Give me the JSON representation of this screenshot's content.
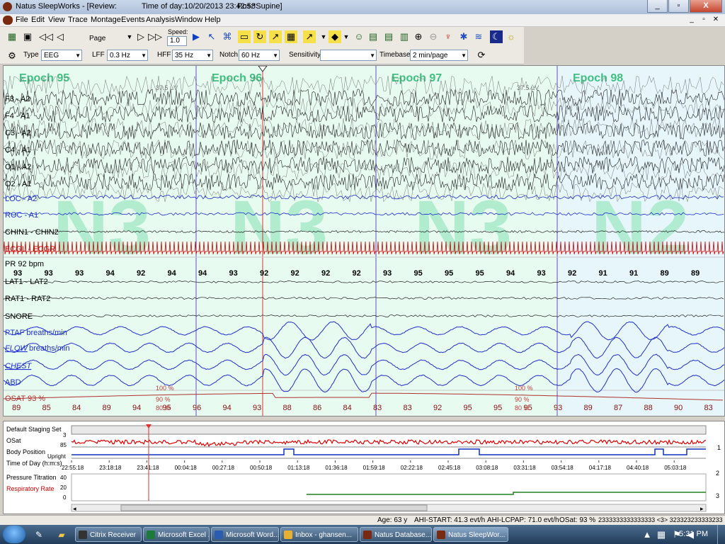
{
  "window": {
    "app_title": "Natus SleepWorks - [Review:",
    "time_of_day": "Time of day:10/20/2013 23:42:58",
    "position": "Pos:*Supine]",
    "controls": [
      "_",
      "▫",
      "X"
    ]
  },
  "menu": [
    "File",
    "Edit",
    "View",
    "Trace",
    "Montage",
    "Events",
    "Analysis",
    "Window",
    "Help"
  ],
  "toolbar": {
    "page_label": "Page",
    "speed_label": "Speed:",
    "speed_value": "1.0"
  },
  "settings": {
    "type_label": "Type",
    "type_value": "EEG",
    "lff_label": "LFF",
    "lff_value": "0.3 Hz",
    "hff_label": "HFF",
    "hff_value": "35 Hz",
    "notch_label": "Notch",
    "notch_value": "60 Hz",
    "sensitivity_label": "Sensitivity",
    "sensitivity_value": "",
    "timebase_label": "Timebase",
    "timebase_value": "2 min/page"
  },
  "epochs": [
    "Epoch 95",
    "Epoch 96",
    "Epoch 97",
    "Epoch 98"
  ],
  "stages": [
    "N3",
    "N3",
    "N3",
    "N2"
  ],
  "scale_labels": [
    "37.5 µV",
    "37.5 µV"
  ],
  "eeg_channels": [
    "F3 - A2",
    "F4 - A1",
    "C3 - A2",
    "C4 - A1",
    "O1 - A2",
    "O2 - A1"
  ],
  "channels": {
    "loc": "LOC - A2",
    "roc": "ROC - A1",
    "chin": "CHIN1 - CHIN2",
    "ecg": "ECGL - ECGR",
    "pr": "PR  92 bpm",
    "lat": "LAT1 - LAT2",
    "rat": "RAT1 - RAT2",
    "snore": "SNORE",
    "ptaf": "PTAF breaths/min",
    "flow": "FLOW",
    "flow_unit": "breaths/min",
    "chest": "CHEST",
    "abd": "ABD",
    "osat": "OSAT 93 %"
  },
  "pr_values": [
    "93",
    "93",
    "93",
    "94",
    "92",
    "94",
    "94",
    "93",
    "92",
    "92",
    "92",
    "92",
    "93",
    "95",
    "95",
    "95",
    "94",
    "93",
    "92",
    "91",
    "91",
    "89",
    "89"
  ],
  "osat_values": [
    "89",
    "85",
    "84",
    "89",
    "94",
    "95",
    "96",
    "94",
    "93",
    "88",
    "86",
    "84",
    "83",
    "83",
    "92",
    "95",
    "95",
    "95",
    "93",
    "89",
    "87",
    "88",
    "90",
    "83"
  ],
  "osat_scale": [
    "100 %",
    "90 %",
    "80 %",
    "100 %",
    "90 %",
    "80 %"
  ],
  "lower_panel": {
    "staging_label": "Default Staging Set",
    "staging_value": "3",
    "osat_label": "OSat",
    "osat_scale": "85",
    "body_label": "Body Position",
    "body_value": "Upright",
    "tod_label": "Time of Day (h:m:s)",
    "times": [
      "22:55:18",
      "23:18:18",
      "23:41:18",
      "00:04:18",
      "00:27:18",
      "00:50:18",
      "01:13:18",
      "01:36:18",
      "01:59:18",
      "02:22:18",
      "02:45:18",
      "03:08:18",
      "03:31:18",
      "03:54:18",
      "04:17:18",
      "04:40:18",
      "05:03:18"
    ],
    "pressure_label": "Pressure Titration",
    "resp_label": "Respiratory Rate",
    "y_ticks": [
      "40",
      "20",
      "0"
    ],
    "side_nums": [
      "1",
      "2",
      "3"
    ]
  },
  "status": {
    "age": "Age: 63 y",
    "ahi_start": "AHI-START: 41.3 evt/h",
    "ahi_lcpap": "AHI-LCPAP: 71.0 evt/h",
    "osat": "OSat: 93 %",
    "stage_string": "2333333333333333 <3> 323323233333233"
  },
  "taskbar": {
    "items": [
      "Citrix Receiver",
      "Microsoft Excel ...",
      "Microsoft Word...",
      "Inbox - ghansen...",
      "Natus Database...",
      "Natus SleepWor..."
    ],
    "clock": "5:31 PM"
  },
  "colors": {
    "eeg": "#202020",
    "blue": "#1f2fd0",
    "red": "#d00000",
    "stage": "#9fe7c4",
    "epoch": "#40c080",
    "pane": "#e8fbf0"
  }
}
